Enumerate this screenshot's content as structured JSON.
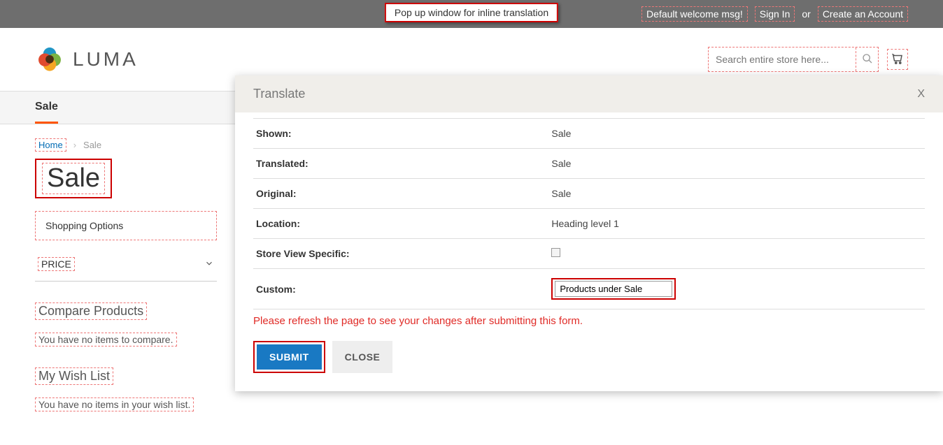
{
  "annotation_caption": "Pop up window for inline translation",
  "topbar": {
    "welcome": "Default welcome msg!",
    "sign_in": "Sign In",
    "or": "or",
    "create_account": "Create an Account"
  },
  "header": {
    "brand": "LUMA",
    "search_placeholder": "Search entire store here..."
  },
  "nav": {
    "active": "Sale"
  },
  "breadcrumb": {
    "home": "Home",
    "current": "Sale"
  },
  "page_title": "Sale",
  "sidebar": {
    "shopping_options": "Shopping Options",
    "price": "PRICE",
    "compare_heading": "Compare Products",
    "compare_empty": "You have no items to compare.",
    "wishlist_heading": "My Wish List",
    "wishlist_empty": "You have no items in your wish list."
  },
  "modal": {
    "title": "Translate",
    "close": "X",
    "rows": {
      "shown_label": "Shown:",
      "shown_value": "Sale",
      "translated_label": "Translated:",
      "translated_value": "Sale",
      "original_label": "Original:",
      "original_value": "Sale",
      "location_label": "Location:",
      "location_value": "Heading level 1",
      "storeview_label": "Store View Specific:",
      "custom_label": "Custom:",
      "custom_value": "Products under Sale"
    },
    "note": "Please refresh the page to see your changes after submitting this form.",
    "submit": "SUBMIT",
    "close_btn": "CLOSE"
  }
}
